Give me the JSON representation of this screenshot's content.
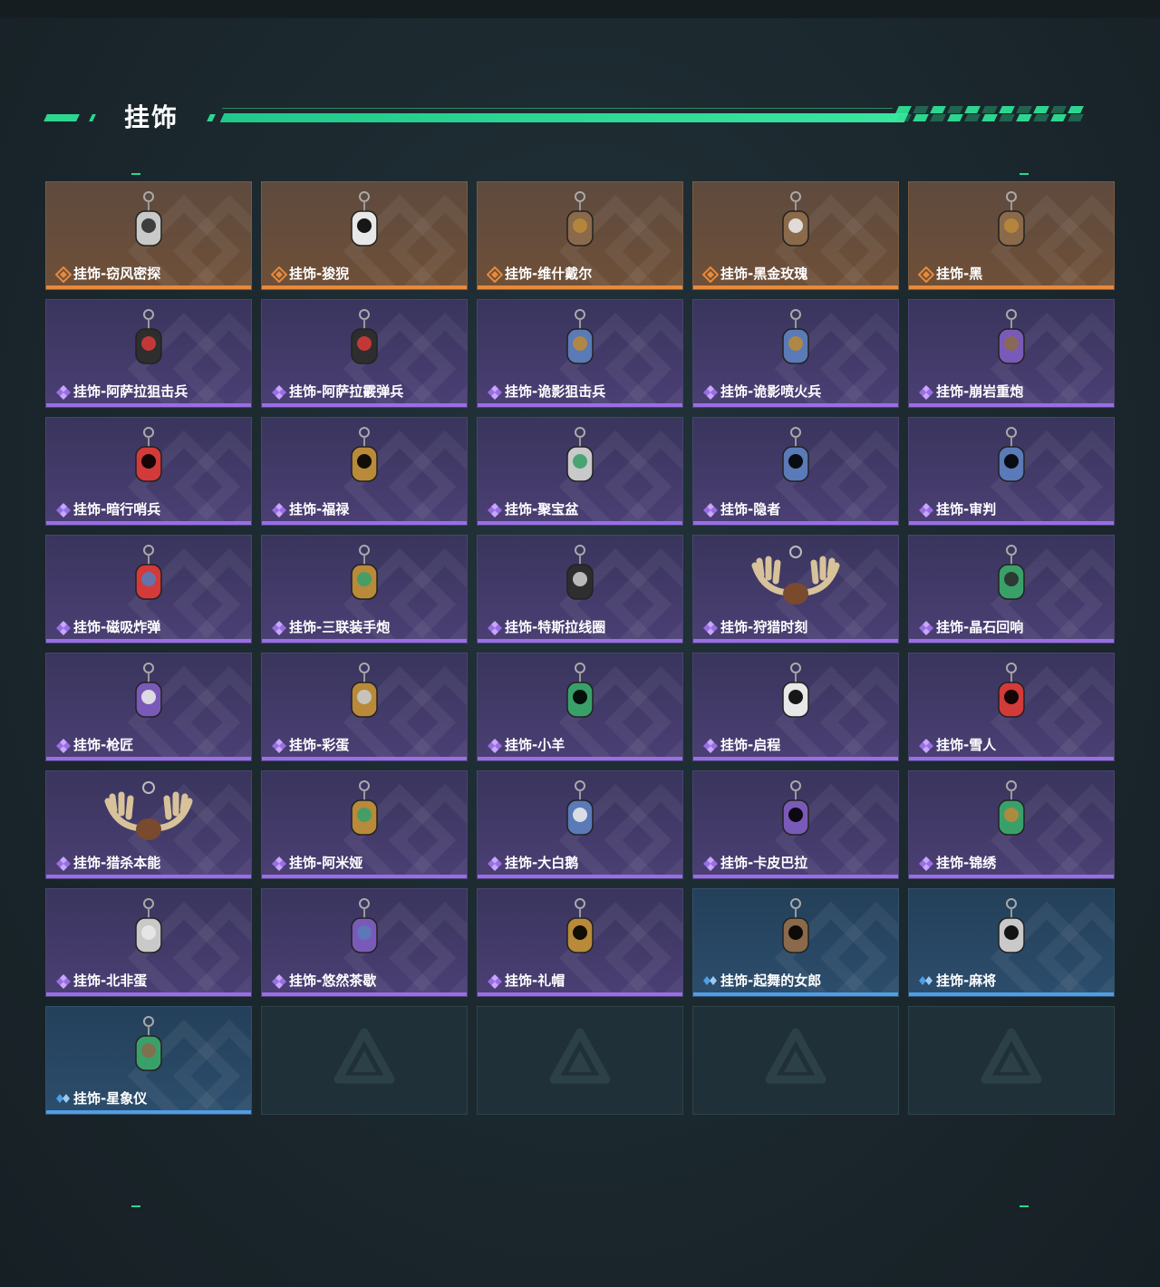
{
  "header": {
    "title": "挂饰"
  },
  "colors": {
    "accent": "#2dd68e",
    "orange": "#e88a3c",
    "purple": "#9a6ee6",
    "blue": "#4f9ee6"
  },
  "items": [
    {
      "label": "挂饰-窃风密探",
      "rarity": "orange",
      "icon": "rabbit-charm-icon"
    },
    {
      "label": "挂饰-狻猊",
      "rarity": "orange",
      "icon": "purple-lion-charm-icon"
    },
    {
      "label": "挂饰-维什戴尔",
      "rarity": "orange",
      "icon": "card-tag-charm-icon"
    },
    {
      "label": "挂饰-黑金玫瑰",
      "rarity": "orange",
      "icon": "black-gold-rose-charm-icon"
    },
    {
      "label": "挂饰-黑",
      "rarity": "orange",
      "icon": "card-tag-charm-icon"
    },
    {
      "label": "挂饰-阿萨拉狙击兵",
      "rarity": "purple",
      "icon": "soldier-figure-charm-icon"
    },
    {
      "label": "挂饰-阿萨拉霰弹兵",
      "rarity": "purple",
      "icon": "soldier-figure-charm-icon"
    },
    {
      "label": "挂饰-诡影狙击兵",
      "rarity": "purple",
      "icon": "masked-soldier-charm-icon"
    },
    {
      "label": "挂饰-诡影喷火兵",
      "rarity": "purple",
      "icon": "masked-soldier-charm-icon"
    },
    {
      "label": "挂饰-崩岩重炮",
      "rarity": "purple",
      "icon": "heavy-soldier-charm-icon"
    },
    {
      "label": "挂饰-暗行哨兵",
      "rarity": "purple",
      "icon": "sentry-charm-icon"
    },
    {
      "label": "挂饰-福禄",
      "rarity": "purple",
      "icon": "gourd-charm-icon"
    },
    {
      "label": "挂饰-聚宝盆",
      "rarity": "purple",
      "icon": "treasure-bowl-charm-icon"
    },
    {
      "label": "挂饰-隐者",
      "rarity": "purple",
      "icon": "tarot-card-charm-icon"
    },
    {
      "label": "挂饰-审判",
      "rarity": "purple",
      "icon": "tarot-card-charm-icon"
    },
    {
      "label": "挂饰-磁吸炸弹",
      "rarity": "purple",
      "icon": "magnetic-bomb-charm-icon"
    },
    {
      "label": "挂饰-三联装手炮",
      "rarity": "purple",
      "icon": "hand-cannon-charm-icon"
    },
    {
      "label": "挂饰-特斯拉线圈",
      "rarity": "purple",
      "icon": "tesla-coil-charm-icon"
    },
    {
      "label": "挂饰-狩猎时刻",
      "rarity": "purple",
      "icon": "antler-charm-icon"
    },
    {
      "label": "挂饰-晶石回响",
      "rarity": "purple",
      "icon": "crystal-charm-icon"
    },
    {
      "label": "挂饰-枪匠",
      "rarity": "purple",
      "icon": "gun-part-charm-icon"
    },
    {
      "label": "挂饰-彩蛋",
      "rarity": "purple",
      "icon": "easter-egg-charm-icon"
    },
    {
      "label": "挂饰-小羊",
      "rarity": "purple",
      "icon": "lamb-charm-icon"
    },
    {
      "label": "挂饰-启程",
      "rarity": "purple",
      "icon": "medal-charm-icon"
    },
    {
      "label": "挂饰-雪人",
      "rarity": "purple",
      "icon": "snowman-charm-icon"
    },
    {
      "label": "挂饰-猎杀本能",
      "rarity": "purple",
      "icon": "antler-charm-icon"
    },
    {
      "label": "挂饰-阿米娅",
      "rarity": "purple",
      "icon": "bunny-figure-charm-icon"
    },
    {
      "label": "挂饰-大白鹅",
      "rarity": "purple",
      "icon": "goose-charm-icon"
    },
    {
      "label": "挂饰-卡皮巴拉",
      "rarity": "purple",
      "icon": "capybara-charm-icon"
    },
    {
      "label": "挂饰-锦绣",
      "rarity": "purple",
      "icon": "butterfly-charm-icon"
    },
    {
      "label": "挂饰-北非蛋",
      "rarity": "purple",
      "icon": "shakshuka-charm-icon"
    },
    {
      "label": "挂饰-悠然茶歇",
      "rarity": "purple",
      "icon": "cupcake-charm-icon"
    },
    {
      "label": "挂饰-礼帽",
      "rarity": "purple",
      "icon": "fedora-charm-icon"
    },
    {
      "label": "挂饰-起舞的女郎",
      "rarity": "blue",
      "icon": "dancer-figure-charm-icon"
    },
    {
      "label": "挂饰-麻将",
      "rarity": "blue",
      "icon": "mahjong-tile-charm-icon"
    },
    {
      "label": "挂饰-星象仪",
      "rarity": "blue",
      "icon": "astrolabe-charm-icon"
    },
    {
      "label": "",
      "rarity": "empty",
      "icon": "empty-slot-logo-icon"
    },
    {
      "label": "",
      "rarity": "empty",
      "icon": "empty-slot-logo-icon"
    },
    {
      "label": "",
      "rarity": "empty",
      "icon": "empty-slot-logo-icon"
    },
    {
      "label": "",
      "rarity": "empty",
      "icon": "empty-slot-logo-icon"
    }
  ]
}
